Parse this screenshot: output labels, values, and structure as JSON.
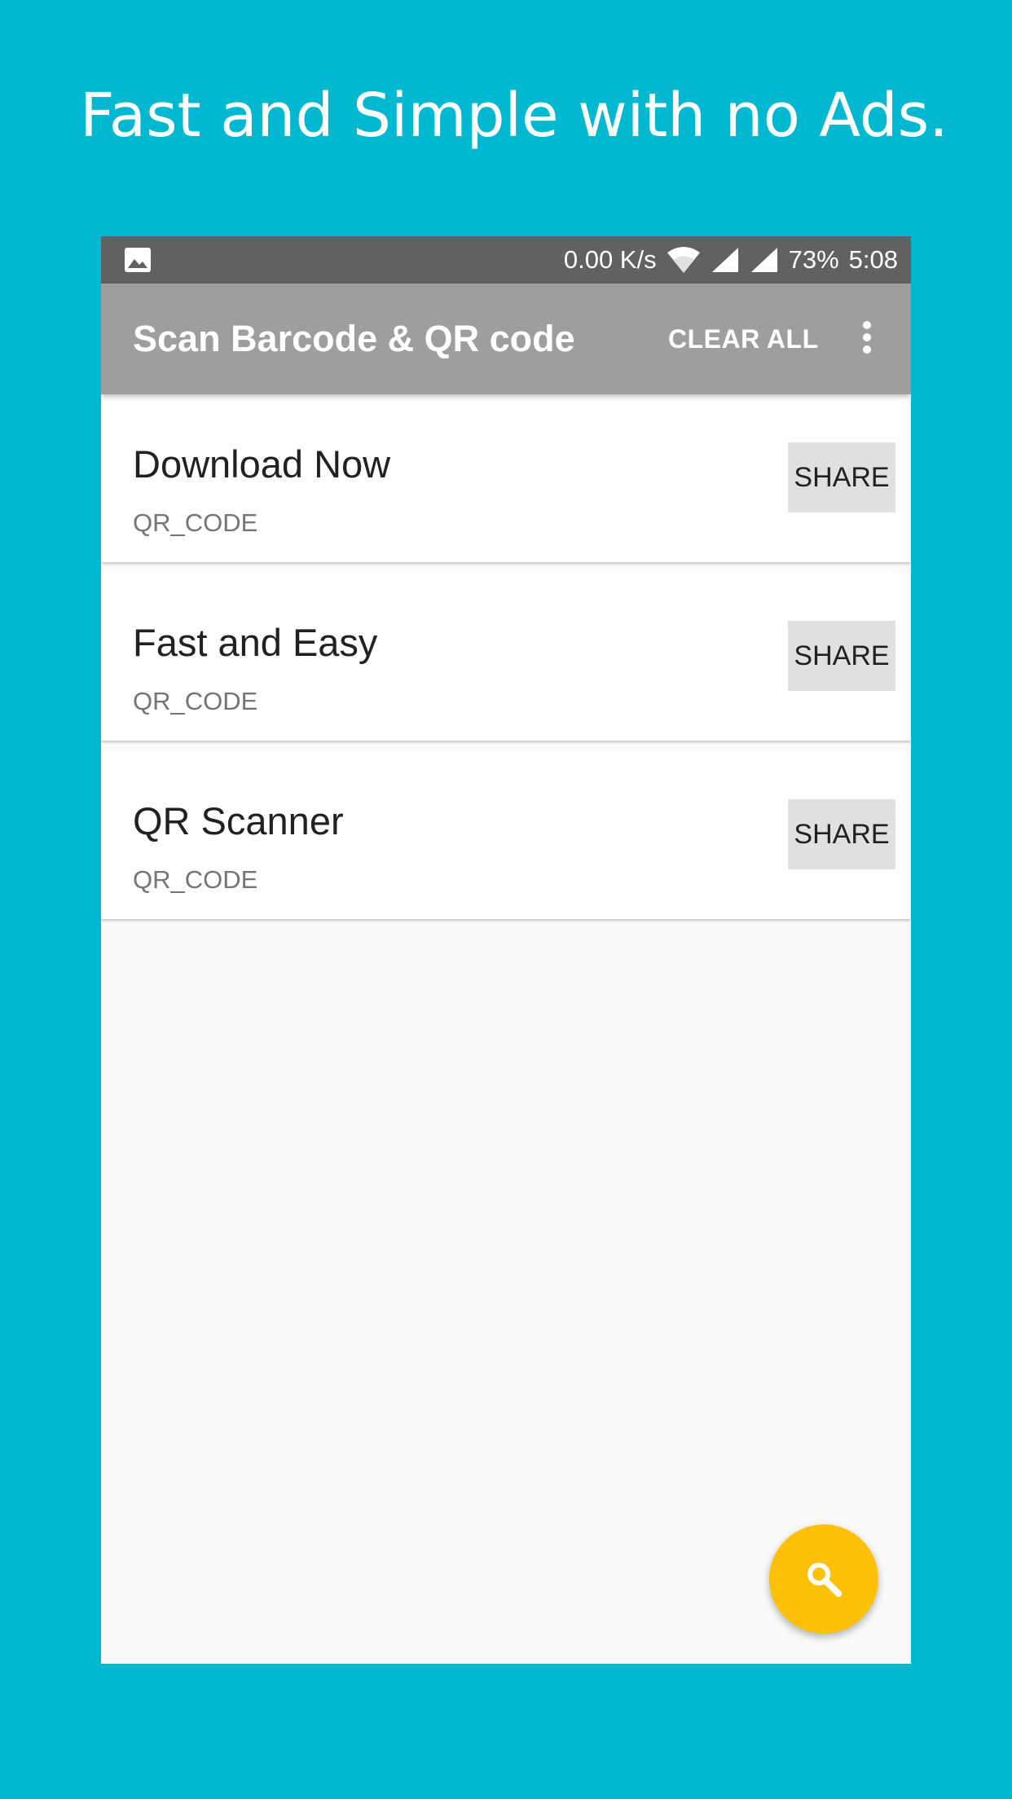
{
  "promo": {
    "headline": "Fast and Simple with no Ads."
  },
  "status_bar": {
    "left_icon": "image-icon",
    "network_speed": "0.00 K/s",
    "icons": [
      "wifi-icon",
      "signal-icon",
      "signal-icon"
    ],
    "battery": "73%",
    "time": "5:08"
  },
  "app_bar": {
    "title": "Scan Barcode & QR code",
    "clear_all_label": "CLEAR ALL",
    "overflow_icon": "more-vert-icon"
  },
  "history": [
    {
      "text": "Download Now",
      "format": "QR_CODE",
      "share_label": "SHARE"
    },
    {
      "text": "Fast and Easy",
      "format": "QR_CODE",
      "share_label": "SHARE"
    },
    {
      "text": "QR Scanner",
      "format": "QR_CODE",
      "share_label": "SHARE"
    }
  ],
  "fab": {
    "icon": "search-icon"
  },
  "colors": {
    "background": "#00b8d0",
    "status_bar": "#616161",
    "app_bar": "#9e9e9e",
    "fab": "#ffc107",
    "share_button": "#e0e0e0"
  }
}
